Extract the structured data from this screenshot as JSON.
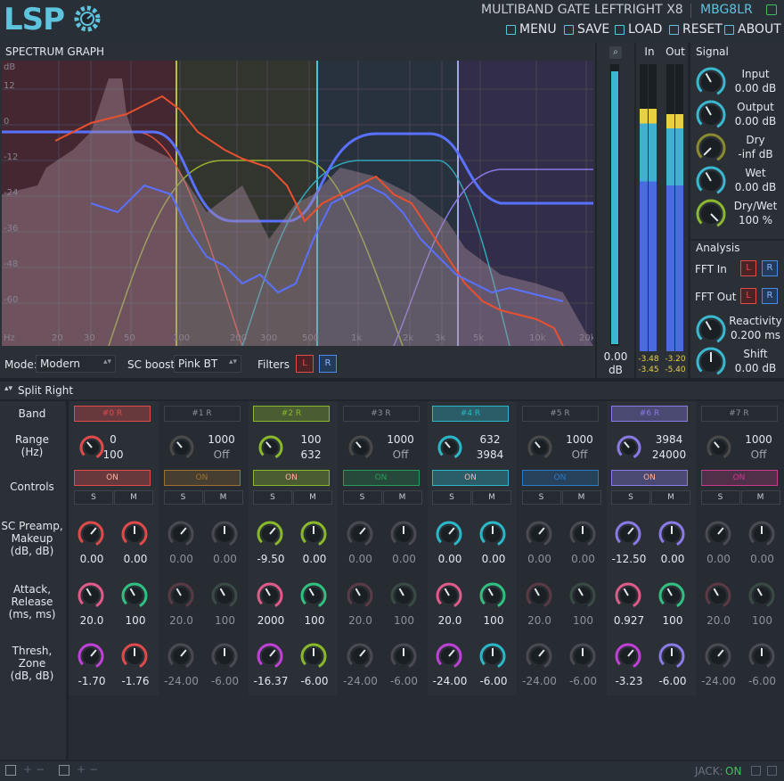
{
  "header": {
    "logo": "LSP",
    "title": "MULTIBAND GATE LEFTRIGHT X8",
    "id": "MBG8LR",
    "menu": [
      "MENU",
      "SAVE",
      "LOAD",
      "RESET",
      "ABOUT"
    ],
    "accent": "#5ec3dd"
  },
  "graph": {
    "title": "SPECTRUM GRAPH",
    "db_unit": "dB",
    "db_ticks": [
      "12",
      "0",
      "-12",
      "-24",
      "-36",
      "-48",
      "-60"
    ],
    "freq_unit": "Hz",
    "freq_ticks": [
      "20",
      "30",
      "50",
      "100",
      "200",
      "300",
      "500",
      "1k",
      "2k",
      "3k",
      "5k",
      "10k",
      "20k"
    ]
  },
  "graph_ctrl": {
    "mode_label": "Mode:",
    "mode_value": "Modern",
    "sc_label": "SC boost:",
    "sc_value": "Pink BT",
    "filters_label": "Filters",
    "l": "L",
    "r": "R"
  },
  "meters": {
    "vu_value": "0.00",
    "vu_unit": "dB",
    "in_label": "In",
    "out_label": "Out",
    "in_peaks": [
      "-3.48",
      "-3.45"
    ],
    "out_peaks": [
      "-3.20",
      "-5.40"
    ]
  },
  "signal": {
    "title": "Signal",
    "items": [
      {
        "label": "Input",
        "value": "0.00 dB"
      },
      {
        "label": "Output",
        "value": "0.00 dB"
      },
      {
        "label": "Dry",
        "value": "-inf dB"
      },
      {
        "label": "Wet",
        "value": "0.00 dB"
      },
      {
        "label": "Dry/Wet",
        "value": "100 %"
      }
    ]
  },
  "analysis": {
    "title": "Analysis",
    "fft_in": "FFT In",
    "fft_out": "FFT Out",
    "l": "L",
    "r": "R",
    "reactivity_label": "Reactivity",
    "reactivity_value": "0.200 ms",
    "shift_label": "Shift",
    "shift_value": "0.00 dB"
  },
  "split": {
    "title": "Split Right"
  },
  "rows": {
    "band": "Band",
    "range": "Range\n(Hz)",
    "controls": "Controls",
    "sc": "SC Preamp,\nMakeup\n(dB, dB)",
    "attack": "Attack,\nRelease\n(ms, ms)",
    "thresh": "Thresh,\nZone\n(dB, dB)"
  },
  "bands": [
    {
      "name": "#0 R",
      "color": "#e04a4a",
      "active": true,
      "range_top": "0",
      "range_bot": "100",
      "on": "ON",
      "s": "S",
      "m": "M",
      "sc": "0.00",
      "mk": "0.00",
      "att": "20.0",
      "rel": "100",
      "thr": "-1.70",
      "zone": "-1.76"
    },
    {
      "name": "#1 R",
      "color": "#a07030",
      "active": false,
      "range_top": "1000",
      "range_bot": "Off",
      "on": "ON",
      "s": "S",
      "m": "M",
      "sc": "0.00",
      "mk": "0.00",
      "att": "20.0",
      "rel": "100",
      "thr": "-24.00",
      "zone": "-6.00"
    },
    {
      "name": "#2 R",
      "color": "#8ab82a",
      "active": true,
      "range_top": "100",
      "range_bot": "632",
      "on": "ON",
      "s": "S",
      "m": "M",
      "sc": "-9.50",
      "mk": "0.00",
      "att": "2000",
      "rel": "100",
      "thr": "-16.37",
      "zone": "-6.00"
    },
    {
      "name": "#3 R",
      "color": "#2a9a5a",
      "active": false,
      "range_top": "1000",
      "range_bot": "Off",
      "on": "ON",
      "s": "S",
      "m": "M",
      "sc": "0.00",
      "mk": "0.00",
      "att": "20.0",
      "rel": "100",
      "thr": "-24.00",
      "zone": "-6.00"
    },
    {
      "name": "#4 R",
      "color": "#2ab8c8",
      "active": true,
      "range_top": "632",
      "range_bot": "3984",
      "on": "ON",
      "s": "S",
      "m": "M",
      "sc": "0.00",
      "mk": "0.00",
      "att": "20.0",
      "rel": "100",
      "thr": "-24.00",
      "zone": "-6.00"
    },
    {
      "name": "#5 R",
      "color": "#2a7ac8",
      "active": false,
      "range_top": "1000",
      "range_bot": "Off",
      "on": "ON",
      "s": "S",
      "m": "M",
      "sc": "0.00",
      "mk": "0.00",
      "att": "20.0",
      "rel": "100",
      "thr": "-24.00",
      "zone": "-6.00"
    },
    {
      "name": "#6 R",
      "color": "#8a7ae8",
      "active": true,
      "range_top": "3984",
      "range_bot": "24000",
      "on": "ON",
      "s": "S",
      "m": "M",
      "sc": "-12.50",
      "mk": "0.00",
      "att": "0.927",
      "rel": "100",
      "thr": "-3.23",
      "zone": "-6.00"
    },
    {
      "name": "#7 R",
      "color": "#c83a8a",
      "active": false,
      "range_top": "1000",
      "range_bot": "Off",
      "on": "ON",
      "s": "S",
      "m": "M",
      "sc": "0.00",
      "mk": "0.00",
      "att": "20.0",
      "rel": "100",
      "thr": "-24.00",
      "zone": "-6.00"
    }
  ],
  "footer": {
    "jack_label": "JACK:",
    "jack_value": "ON"
  }
}
